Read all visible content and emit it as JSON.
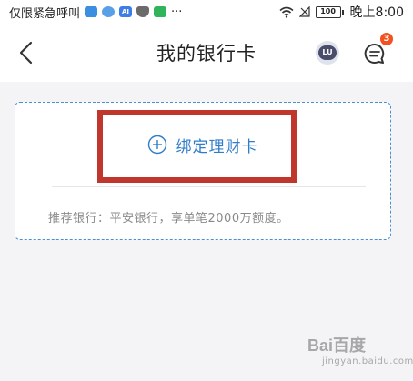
{
  "status_bar": {
    "carrier_text": "仅限紧急呼叫",
    "more": "···",
    "battery": "100",
    "time": "晚上8:00",
    "app_badges": [
      {
        "label": "",
        "color": "#3b8fe0"
      },
      {
        "label": "",
        "color": "#5aa0e6"
      },
      {
        "label": "AI",
        "color": "#3c7ee6"
      },
      {
        "label": "",
        "color": "#6b6b6b"
      },
      {
        "label": "",
        "color": "#30b45a"
      }
    ]
  },
  "header": {
    "title": "我的银行卡",
    "avatar_text": "LU",
    "message_count": "3"
  },
  "card_box": {
    "bind_label": "绑定理财卡",
    "recommend_text": "推荐银行：平安银行，享单笔2000万额度。"
  },
  "watermark": {
    "top": "Bai百度",
    "bottom": "jingyan.baidu.com"
  },
  "colors": {
    "accent": "#2f7dc9",
    "highlight": "#c0362c",
    "badge": "#f4511e"
  }
}
